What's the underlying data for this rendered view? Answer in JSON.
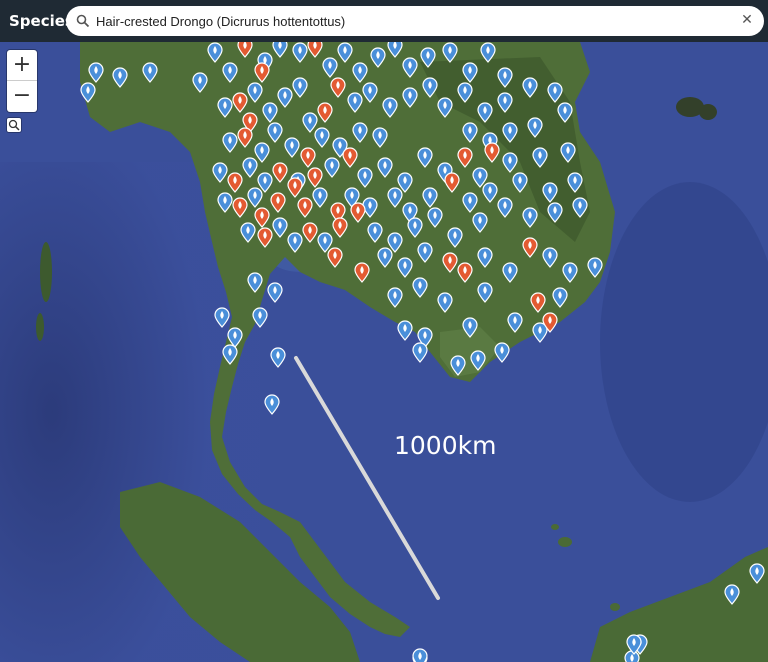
{
  "header": {
    "species_label": "Species:",
    "search_value": "Hair-crested Drongo (Dicrurus hottentottus)"
  },
  "controls": {
    "zoom_in": "+",
    "zoom_out": "−"
  },
  "scale": {
    "label": "1000km"
  },
  "colors": {
    "marker_blue": "#4a8fd9",
    "marker_red": "#e35a32",
    "sea": "#3a4f9a",
    "land": "#4a6a36"
  }
}
